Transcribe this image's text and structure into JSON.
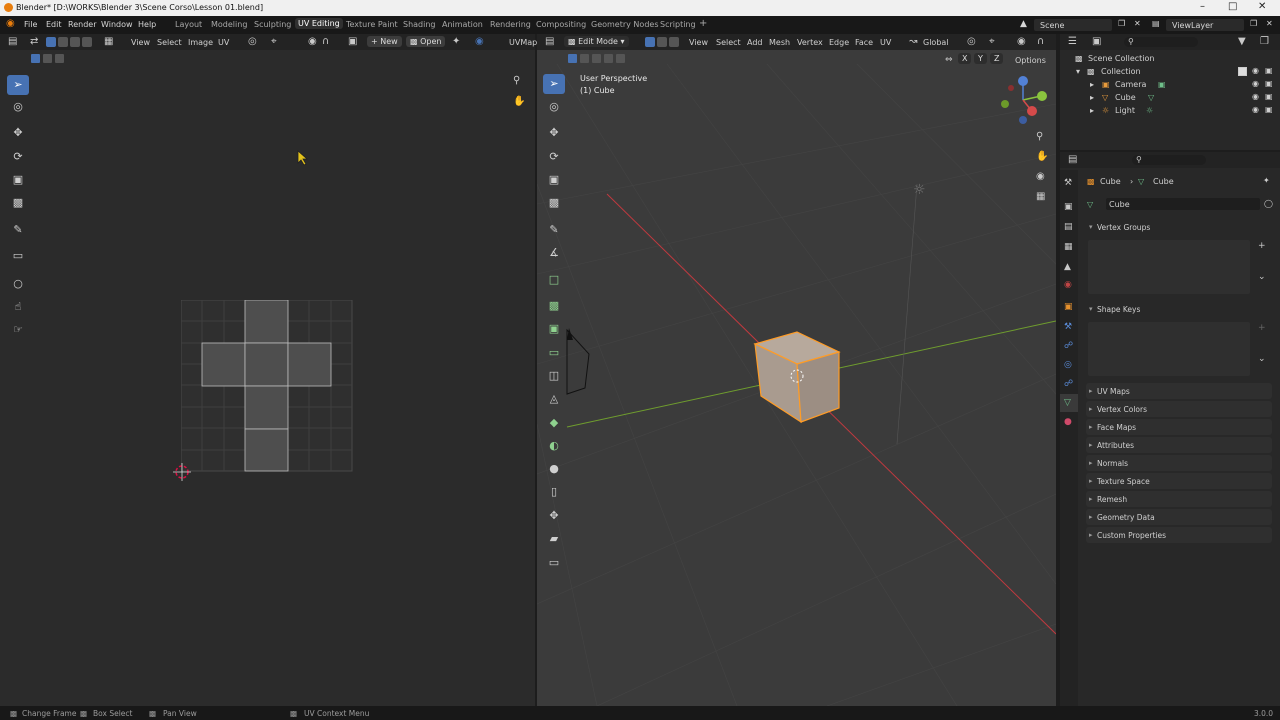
{
  "window": {
    "title": "Blender* [D:\\WORKS\\Blender 3\\Scene Corso\\Lesson 01.blend]"
  },
  "menu": {
    "file": "File",
    "edit": "Edit",
    "render": "Render",
    "window": "Window",
    "help": "Help"
  },
  "workspaces": [
    "Layout",
    "Modeling",
    "Sculpting",
    "UV Editing",
    "Texture Paint",
    "Shading",
    "Animation",
    "Rendering",
    "Compositing",
    "Geometry Nodes",
    "Scripting"
  ],
  "scene": {
    "name": "Scene",
    "view_layer": "ViewLayer"
  },
  "uv_editor": {
    "menus": {
      "view": "View",
      "select": "Select",
      "image": "Image",
      "uv": "UV"
    },
    "new_label": "New",
    "open_label": "Open",
    "uvmap": "UVMap"
  },
  "viewport": {
    "mode": "Edit Mode",
    "menus": {
      "view": "View",
      "select": "Select",
      "add": "Add",
      "mesh": "Mesh",
      "vertex": "Vertex",
      "edge": "Edge",
      "face": "Face",
      "uv": "UV"
    },
    "orientation": "Global",
    "options": "Options",
    "axes": {
      "x": "X",
      "y": "Y",
      "z": "Z"
    },
    "overlay_line1": "User Perspective",
    "overlay_line2": "(1) Cube"
  },
  "outliner": {
    "root": "Scene Collection",
    "collection": "Collection",
    "items": [
      "Camera",
      "Cube",
      "Light"
    ]
  },
  "properties": {
    "object": "Cube",
    "mesh": "Cube",
    "data_name": "Cube",
    "panels": [
      "Vertex Groups",
      "Shape Keys",
      "UV Maps",
      "Vertex Colors",
      "Face Maps",
      "Attributes",
      "Normals",
      "Texture Space",
      "Remesh",
      "Geometry Data",
      "Custom Properties"
    ]
  },
  "status": {
    "change_frame": "Change Frame",
    "box_select": "Box Select",
    "pan_view": "Pan View",
    "uv_context": "UV Context Menu",
    "version": "3.0.0"
  },
  "colors": {
    "accent": "#4772b3",
    "selection": "#ff9c26",
    "x_axis": "#d04646",
    "y_axis": "#6f9d2e"
  }
}
